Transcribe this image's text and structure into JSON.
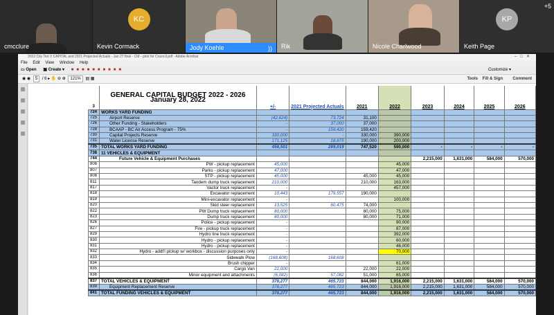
{
  "meeting": {
    "more_count": "+5",
    "participants": [
      {
        "name": "cmcclure",
        "initials": ""
      },
      {
        "name": "Kevin Cormack",
        "initials": "KC",
        "color": "#e6ac2d"
      },
      {
        "name": "Jody Koehle",
        "initials": ""
      },
      {
        "name": "Rik",
        "initials": ""
      },
      {
        "name": "Nicole Charlwood",
        "initials": ""
      },
      {
        "name": "Keith Page",
        "initials": "KP",
        "color": "#a8a8a8"
      }
    ]
  },
  "window": {
    "title": "2022 City Ten V CAPITAL and 2021 Projected Actuals - Jan 27 final - CM - print for Council.pdf - Adobe Acrobat"
  },
  "menu": [
    "File",
    "Edit",
    "View",
    "Window",
    "Help"
  ],
  "toolbar": {
    "open": "Open",
    "create": "Create",
    "customize": "Customize"
  },
  "nav": {
    "page": "5",
    "pages": "/ 6",
    "zoom": "121%",
    "tools": "Tools",
    "fill_sign": "Fill & Sign",
    "comment": "Comment"
  },
  "sheet": {
    "title": "GENERAL CAPITAL BUDGET 2022 - 2026",
    "date": "January 28, 2022",
    "row_num": "3",
    "headers": {
      "pm": "+/-",
      "pa": "2021 Projected Actuals",
      "y2021": "2021",
      "y2022": "2022",
      "y2023": "2023",
      "y2024": "2024",
      "y2025": "2025",
      "y2026": "2026"
    },
    "rows": [
      {
        "ln": "724",
        "label": "WORKS YARD FUNDING",
        "cls": "blue sec",
        "v": [
          "",
          "",
          "",
          "",
          "",
          "",
          "",
          ""
        ]
      },
      {
        "ln": "725",
        "label": "Airport Reserve",
        "cls": "blue",
        "indent": 1,
        "v": [
          "(42,624)",
          "73,724",
          "31,100",
          "",
          "",
          "",
          "",
          ""
        ]
      },
      {
        "ln": "726",
        "label": "Other Funding - Stakeholders",
        "cls": "blue",
        "indent": 1,
        "v": [
          "-",
          "37,000",
          "37,000",
          "",
          "",
          "",
          "",
          ""
        ]
      },
      {
        "ln": "728",
        "label": "BCAAP - BC Air Access Program - 75%",
        "cls": "blue",
        "indent": 1,
        "v": [
          "-",
          "159,420",
          "159,420",
          "",
          "",
          "",
          "",
          ""
        ]
      },
      {
        "ln": "730",
        "label": "Capital Projects Reserve",
        "cls": "blue",
        "indent": 1,
        "v": [
          "330,000",
          "-",
          "330,000",
          "390,000",
          "",
          "",
          "",
          ""
        ]
      },
      {
        "ln": "731",
        "label": "Water License Reserve",
        "cls": "blue",
        "indent": 1,
        "v": [
          "171,125",
          "18,875",
          "190,000",
          "200,000",
          "",
          "",
          "",
          ""
        ]
      },
      {
        "ln": "735",
        "label": "TOTAL WORKS YARD FUNDING",
        "cls": "blue tot",
        "v": [
          "458,501",
          "289,019",
          "747,520",
          "590,000",
          "-",
          "-",
          "-",
          "-"
        ]
      },
      {
        "ln": "738",
        "label": "11 VEHICLES & EQUIPMENT",
        "cls": "blue sec",
        "v": [
          "",
          "",
          "",
          "",
          "",
          "",
          "",
          ""
        ]
      },
      {
        "ln": "744",
        "label": "Future Vehicle & Equipment Purchases",
        "cls": "sec",
        "indent": 2,
        "v": [
          "",
          "",
          "",
          "",
          "2,215,000",
          "1,631,000",
          "584,000",
          "570,000"
        ]
      },
      {
        "ln": "806",
        "label": "PW - pickup replacement",
        "align": "r",
        "v": [
          "45,000",
          "",
          "",
          "45,000",
          "",
          "",
          "",
          ""
        ]
      },
      {
        "ln": "807",
        "label": "Parks - pickup replacement",
        "align": "r",
        "v": [
          "47,000",
          "",
          "",
          "47,000",
          "",
          "",
          "",
          ""
        ]
      },
      {
        "ln": "808",
        "label": "STP - pickup replacement",
        "align": "r",
        "v": [
          "45,000",
          "",
          "45,000",
          "45,000",
          "",
          "",
          "",
          ""
        ]
      },
      {
        "ln": "811",
        "label": "Tandem dump truck replacement",
        "align": "r",
        "v": [
          "210,000",
          "",
          "210,000",
          "163,000",
          "",
          "",
          "",
          ""
        ]
      },
      {
        "ln": "817",
        "label": "Vactor truck replacement",
        "align": "r",
        "v": [
          "-",
          "",
          "",
          "457,000",
          "",
          "",
          "",
          ""
        ]
      },
      {
        "ln": "818",
        "label": "Excavator replacement",
        "align": "r",
        "v": [
          "10,443",
          "179,557",
          "190,000",
          "",
          "",
          "",
          "",
          ""
        ]
      },
      {
        "ln": "819",
        "label": "Mini-excavator replacement",
        "align": "r",
        "v": [
          "-",
          "",
          "",
          "100,000",
          "",
          "",
          "",
          ""
        ]
      },
      {
        "ln": "820",
        "label": "Skid steer replacement",
        "align": "r",
        "v": [
          "13,525",
          "60,475",
          "74,000",
          "",
          "",
          "",
          "",
          ""
        ]
      },
      {
        "ln": "822",
        "label": "PW Dump truck replacement",
        "align": "r",
        "v": [
          "80,000",
          "",
          "80,000",
          "75,000",
          "",
          "",
          "",
          ""
        ]
      },
      {
        "ln": "823",
        "label": "Dump truck replacement",
        "align": "r",
        "v": [
          "80,000",
          "",
          "80,000",
          "71,000",
          "",
          "",
          "",
          ""
        ]
      },
      {
        "ln": "826",
        "label": "Police - pickup replacement",
        "align": "r",
        "v": [
          "-",
          "",
          "",
          "90,000",
          "",
          "",
          "",
          ""
        ]
      },
      {
        "ln": "827",
        "label": "Fire - pickup truck replacement",
        "align": "r",
        "v": [
          "-",
          "",
          "",
          "87,000",
          "",
          "",
          "",
          ""
        ]
      },
      {
        "ln": "829",
        "label": "Hydro line truck replacement",
        "align": "r",
        "v": [
          "-",
          "",
          "",
          "392,000",
          "",
          "",
          "",
          ""
        ]
      },
      {
        "ln": "830",
        "label": "Hydro - pickup replacement",
        "align": "r",
        "v": [
          "-",
          "",
          "",
          "60,000",
          "",
          "",
          "",
          ""
        ]
      },
      {
        "ln": "831",
        "label": "Hydro - pickup replacement",
        "align": "r",
        "v": [
          "-",
          "",
          "",
          "46,000",
          "",
          "",
          "",
          ""
        ]
      },
      {
        "ln": "832",
        "label": "Hydro - addt'l pickup w/ workbox - discussion purposes only",
        "cls": "hl",
        "align": "r",
        "v": [
          "-",
          "",
          "",
          "70,000",
          "",
          "",
          "",
          ""
        ]
      },
      {
        "ln": "833",
        "label": "Sidewalk Plow",
        "align": "r",
        "v": [
          "(168,608)",
          "168,608",
          "",
          "",
          "",
          "",
          "",
          ""
        ]
      },
      {
        "ln": "834",
        "label": "Brush chipper",
        "align": "r",
        "v": [
          "-",
          "",
          "",
          "61,000",
          "",
          "",
          "",
          ""
        ]
      },
      {
        "ln": "835",
        "label": "Cargo Van",
        "align": "r",
        "v": [
          "22,000",
          "",
          "22,000",
          "22,000",
          "",
          "",
          "",
          ""
        ]
      },
      {
        "ln": "836",
        "label": "Minor equipment and attachments",
        "align": "r",
        "v": [
          "(6,082)",
          "57,082",
          "51,000",
          "65,000",
          "",
          "",
          "",
          ""
        ]
      },
      {
        "ln": "837",
        "label": "TOTAL VEHICLES & EQUIPMENT",
        "cls": "tot",
        "v": [
          "378,277",
          "465,723",
          "844,000",
          "1,916,000",
          "2,215,000",
          "1,631,000",
          "584,000",
          "570,000"
        ]
      },
      {
        "ln": "839",
        "label": "Equipment Replacement Reserve",
        "cls": "blue",
        "indent": 1,
        "v": [
          "378,277",
          "465,723",
          "844,000",
          "1,916,000",
          "2,215,000",
          "1,631,000",
          "584,000",
          "570,000"
        ]
      },
      {
        "ln": "841",
        "label": "TOTAL FUNDING VEHICLES & EQUIPMENT",
        "cls": "blue tot",
        "v": [
          "378,277",
          "465,723",
          "844,000",
          "1,916,000",
          "2,215,000",
          "1,631,000",
          "584,000",
          "570,000"
        ]
      }
    ]
  }
}
